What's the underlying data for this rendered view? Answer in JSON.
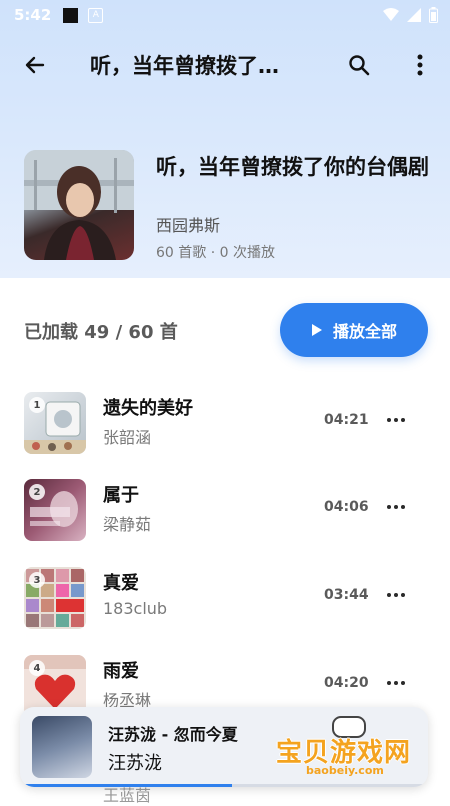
{
  "status": {
    "time": "5:42"
  },
  "topbar": {
    "title": "听，当年曾撩拨了…"
  },
  "album": {
    "title": "听，当年曾撩拨了你的台偶剧",
    "artist": "西园弗斯",
    "meta": "60 首歌 · 0 次播放"
  },
  "list_header": {
    "loaded": "已加载 49 / 60 首",
    "play_all": "播放全部"
  },
  "songs": [
    {
      "num": "1",
      "title": "遗失的美好",
      "artist": "张韶涵",
      "duration": "04:21"
    },
    {
      "num": "2",
      "title": "属于",
      "artist": "梁静茹",
      "duration": "04:06"
    },
    {
      "num": "3",
      "title": "真爱",
      "artist": "183club",
      "duration": "03:44"
    },
    {
      "num": "4",
      "title": "雨爱",
      "artist": "杨丞琳",
      "duration": "04:20"
    }
  ],
  "peek_artist": "王蓝茵",
  "now_playing": {
    "title": "汪苏泷 - 忽而今夏",
    "artist": "汪苏泷",
    "progress": 0.52
  },
  "watermark": {
    "text": "宝贝游戏网",
    "url": "baobeiy.com"
  },
  "colors": {
    "accent": "#2f80ed",
    "hero_bg": "#dbe9fc"
  }
}
